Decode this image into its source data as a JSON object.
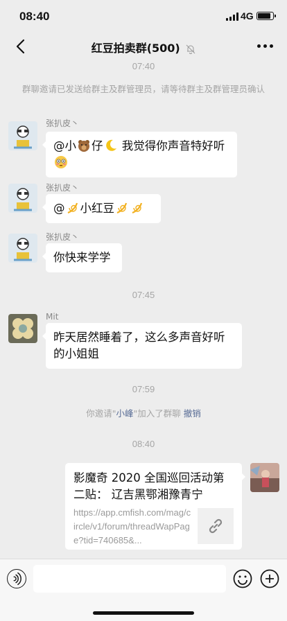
{
  "status": {
    "time": "08:40",
    "network": "4G",
    "battery_level": 0.85
  },
  "nav": {
    "title": "红豆拍卖群(500)"
  },
  "messages": {
    "t1": "07:40",
    "sys1": "群聊邀请已发送给群主及群管理员，请等待群主及群管理员确认",
    "m1": {
      "sender": "张扒皮丶",
      "p1": "@小",
      "p2": "仔",
      "p3": " 我觉得你声音特好听"
    },
    "m2": {
      "sender": "张扒皮丶",
      "p1": "@",
      "p2": "小红豆"
    },
    "m3": {
      "sender": "张扒皮丶",
      "text": "你快来学学"
    },
    "t2": "07:45",
    "m4": {
      "sender": "Mit",
      "text": "昨天居然睡着了，这么多声音好听的小姐姐"
    },
    "t3": "07:59",
    "sys2": {
      "pre": "你邀请\"",
      "name": "小峰",
      "post": "\"加入了群聊 ",
      "action": "撤销"
    },
    "t4": "08:40",
    "card": {
      "title": "影魔奇 2020 全国巡回活动第二贴： 辽吉黑鄂湘豫青宁",
      "url": "https://app.cmfish.com/mag/circle/v1/forum/threadWapPage?tid=740685&..."
    }
  },
  "icons": [
    "back-icon",
    "mute-bell-icon",
    "more-icon",
    "voice-icon",
    "emoji-icon",
    "plus-icon",
    "link-icon"
  ]
}
